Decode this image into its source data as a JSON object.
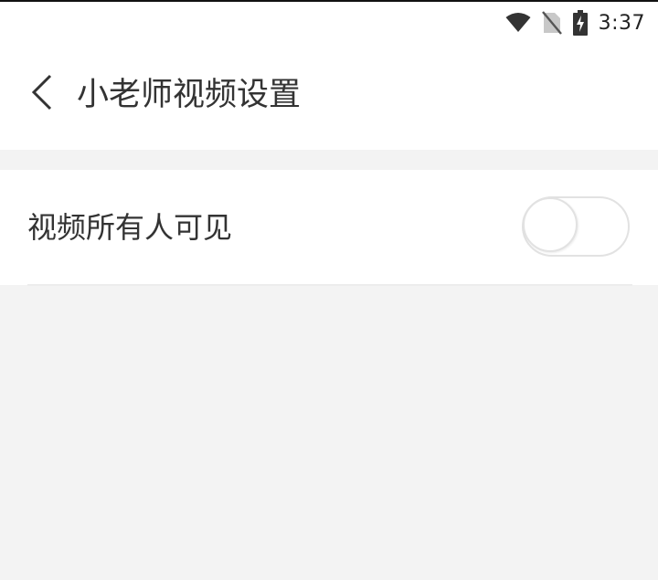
{
  "status_bar": {
    "time": "3:37",
    "icons": [
      "wifi-icon",
      "no-sim-icon",
      "battery-charging-icon"
    ]
  },
  "header": {
    "back_icon": "chevron-left-icon",
    "title": "小老师视频设置"
  },
  "settings": {
    "items": [
      {
        "label": "视频所有人可见",
        "toggle_on": false
      }
    ]
  },
  "colors": {
    "background": "#f3f3f3",
    "surface": "#ffffff",
    "text": "#333333",
    "toggle_border": "#e2e2e2"
  }
}
